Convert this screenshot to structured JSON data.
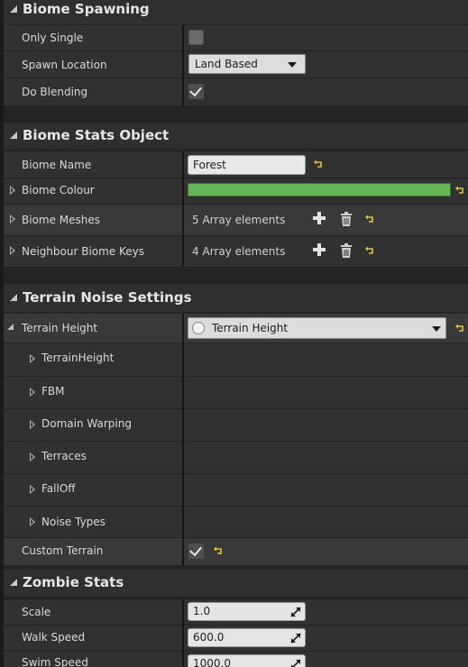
{
  "sections": {
    "biome_spawning": {
      "title": "Biome Spawning",
      "only_single_label": "Only Single",
      "only_single_checked": false,
      "spawn_location_label": "Spawn Location",
      "spawn_location_value": "Land Based",
      "do_blending_label": "Do Blending",
      "do_blending_checked": true
    },
    "biome_stats": {
      "title": "Biome Stats Object",
      "biome_name_label": "Biome Name",
      "biome_name_value": "Forest",
      "biome_colour_label": "Biome Colour",
      "biome_colour_value": "#66b657",
      "biome_meshes_label": "Biome Meshes",
      "biome_meshes_value": "5 Array elements",
      "neighbour_keys_label": "Neighbour Biome Keys",
      "neighbour_keys_value": "4 Array elements"
    },
    "terrain_noise": {
      "title": "Terrain Noise Settings",
      "terrain_height_label": "Terrain Height",
      "terrain_height_value": "Terrain Height",
      "children": [
        "TerrainHeight",
        "FBM",
        "Domain Warping",
        "Terraces",
        "FallOff",
        "Noise Types"
      ],
      "custom_terrain_label": "Custom Terrain",
      "custom_terrain_checked": true
    },
    "zombie_stats": {
      "title": "Zombie Stats",
      "scale_label": "Scale",
      "scale_value": "1.0",
      "walk_speed_label": "Walk Speed",
      "walk_speed_value": "600.0",
      "swim_speed_label": "Swim Speed",
      "swim_speed_value": "1000.0"
    }
  },
  "colors": {
    "panel_bg": "#242424",
    "accent_reset": "#e1c43a"
  }
}
